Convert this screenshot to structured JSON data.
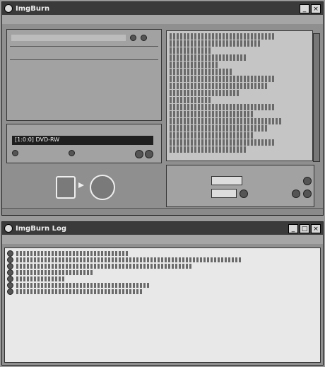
{
  "main": {
    "title": "ImgBurn",
    "menu": [
      "",
      "",
      "",
      "",
      ""
    ],
    "source_label": "",
    "source_value": "",
    "fields_top": [
      {
        "label": "",
        "value": ""
      },
      {
        "label": "",
        "value": ""
      },
      {
        "label": "",
        "value": ""
      }
    ],
    "fields_bottom": [
      {
        "label": "",
        "value": ""
      },
      {
        "label": "",
        "value": ""
      },
      {
        "label": "",
        "value": ""
      }
    ],
    "destination_label": "",
    "destination_value": "[1:0:0] DVD-RW",
    "test_mode_label": "",
    "verify_label": "",
    "settings_label": "",
    "write_speed_label": "",
    "write_speed_value": "",
    "copies_label": "",
    "copies_value": "",
    "speed_unit": "",
    "info_line_count": 17
  },
  "log": {
    "title": "ImgBurn Log",
    "menu": [
      "",
      "",
      ""
    ],
    "line_count": 7
  },
  "icons": {
    "app": "disc-icon",
    "window_controls": [
      "minimize-icon",
      "maximize-icon",
      "close-icon"
    ]
  }
}
